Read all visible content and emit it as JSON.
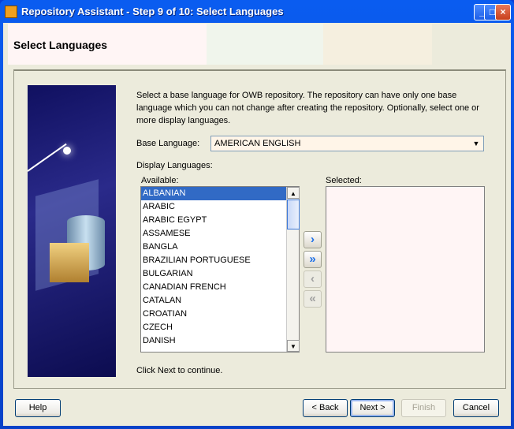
{
  "window": {
    "title": "Repository Assistant - Step 9 of 10: Select Languages"
  },
  "header": {
    "title": "Select Languages",
    "band_colors": [
      "#fff5f5",
      "#f0f5ec",
      "#f5efdf"
    ]
  },
  "intro": "Select a base language for OWB repository. The repository can have only one base language which you can not change after creating the repository.  Optionally, select one or more display languages.",
  "base_language": {
    "label": "Base Language:",
    "value": "AMERICAN ENGLISH"
  },
  "display_languages": {
    "label": "Display Languages:",
    "available_label": "Available:",
    "selected_label": "Selected:",
    "available": [
      "ALBANIAN",
      "ARABIC",
      "ARABIC EGYPT",
      "ASSAMESE",
      "BANGLA",
      "BRAZILIAN PORTUGUESE",
      "BULGARIAN",
      "CANADIAN FRENCH",
      "CATALAN",
      "CROATIAN",
      "CZECH",
      "DANISH"
    ],
    "selected_index": 0,
    "selected": []
  },
  "footer_hint": "Click Next to continue.",
  "buttons": {
    "help": "Help",
    "back": "< Back",
    "next": "Next >",
    "finish": "Finish",
    "cancel": "Cancel"
  }
}
